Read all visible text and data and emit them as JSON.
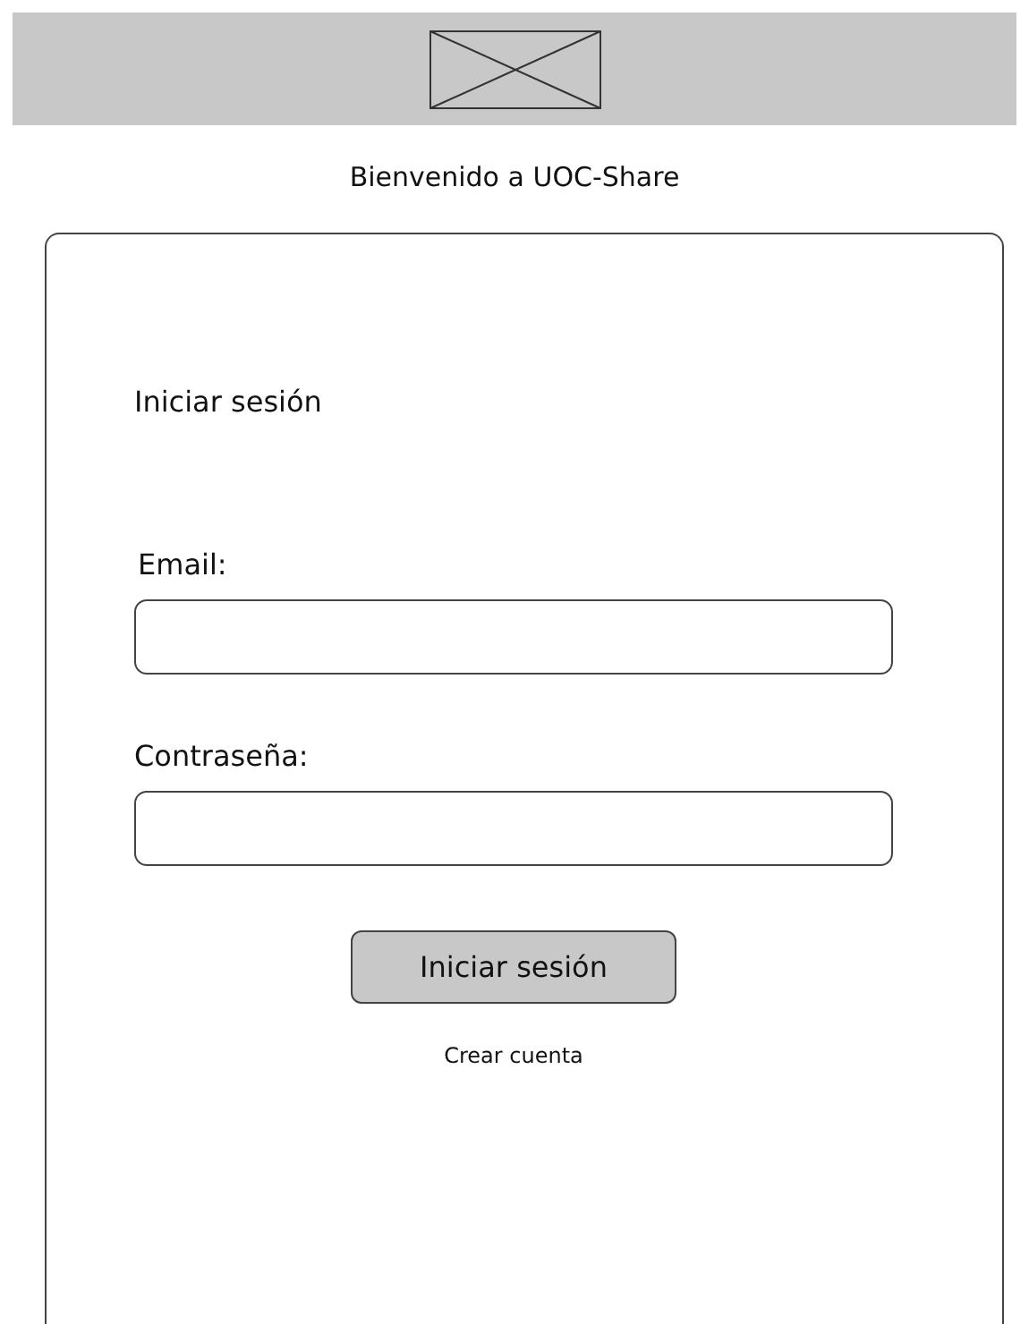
{
  "header": {
    "logo": {
      "kind": "placeholder"
    }
  },
  "title": "Bienvenido a UOC-Share",
  "login_card": {
    "heading": "Iniciar sesión",
    "fields": [
      {
        "label": "Email:"
      },
      {
        "label": "Contraseña:"
      }
    ],
    "submit_button": "Iniciar sesión",
    "link": "Crear cuenta"
  }
}
